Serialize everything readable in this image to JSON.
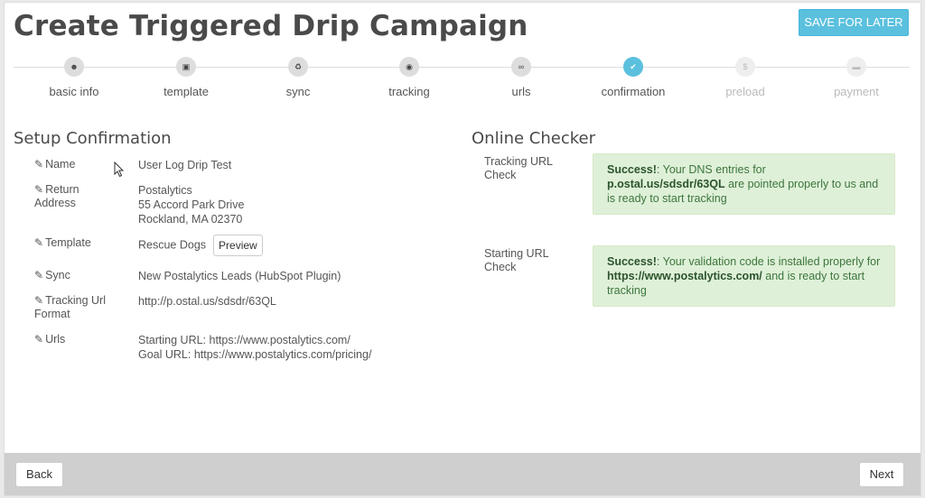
{
  "header": {
    "title": "Create Triggered Drip Campaign",
    "save_label": "SAVE FOR LATER"
  },
  "wizard": {
    "steps": [
      {
        "label": "basic info",
        "icon": "user-icon",
        "glyph": "☻",
        "state": "done"
      },
      {
        "label": "template",
        "icon": "image-icon",
        "glyph": "▣",
        "state": "done"
      },
      {
        "label": "sync",
        "icon": "recycle-icon",
        "glyph": "♻",
        "state": "done"
      },
      {
        "label": "tracking",
        "icon": "target-icon",
        "glyph": "◉",
        "state": "done"
      },
      {
        "label": "urls",
        "icon": "link-icon",
        "glyph": "∞",
        "state": "done"
      },
      {
        "label": "confirmation",
        "icon": "check-icon",
        "glyph": "✔",
        "state": "active"
      },
      {
        "label": "preload",
        "icon": "dollar-icon",
        "glyph": "$",
        "state": "disabled"
      },
      {
        "label": "payment",
        "icon": "credit-card-icon",
        "glyph": "▬",
        "state": "disabled"
      }
    ]
  },
  "setup": {
    "title": "Setup Confirmation",
    "edit_icon": "✎",
    "name_label": "Name",
    "name_value": "User Log Drip Test",
    "return_label_1": "Return",
    "return_label_2": "Address",
    "return_line1": "Postalytics",
    "return_line2": "55 Accord Park Drive",
    "return_line3": "Rockland, MA 02370",
    "template_label": "Template",
    "template_value": "Rescue Dogs",
    "preview_label": "Preview",
    "sync_label": "Sync",
    "sync_value": "New Postalytics Leads (HubSpot Plugin)",
    "tracking_label_1": "Tracking Url",
    "tracking_label_2": "Format",
    "tracking_value": "http://p.ostal.us/sdsdr/63QL",
    "urls_label": "Urls",
    "starting_url": "Starting URL: https://www.postalytics.com/",
    "goal_url": "Goal URL: https://www.postalytics.com/pricing/"
  },
  "checker": {
    "title": "Online Checker",
    "tracking_label_1": "Tracking URL",
    "tracking_label_2": "Check",
    "tracking_success": "Success!",
    "tracking_text_1": ": Your DNS entries for ",
    "tracking_domain": "p.ostal.us/sdsdr/63QL",
    "tracking_text_2": " are pointed properly to us and is ready to start tracking",
    "starting_label_1": "Starting URL",
    "starting_label_2": "Check",
    "starting_success": "Success!",
    "starting_text_1": ": Your validation code is installed properly for ",
    "starting_url": "https://www.postalytics.com/",
    "starting_text_2": " and is ready to start tracking"
  },
  "footer": {
    "back_label": "Back",
    "next_label": "Next"
  },
  "colors": {
    "accent": "#5bc0de",
    "success_bg": "#dff0d8",
    "success_text": "#3c763d"
  }
}
